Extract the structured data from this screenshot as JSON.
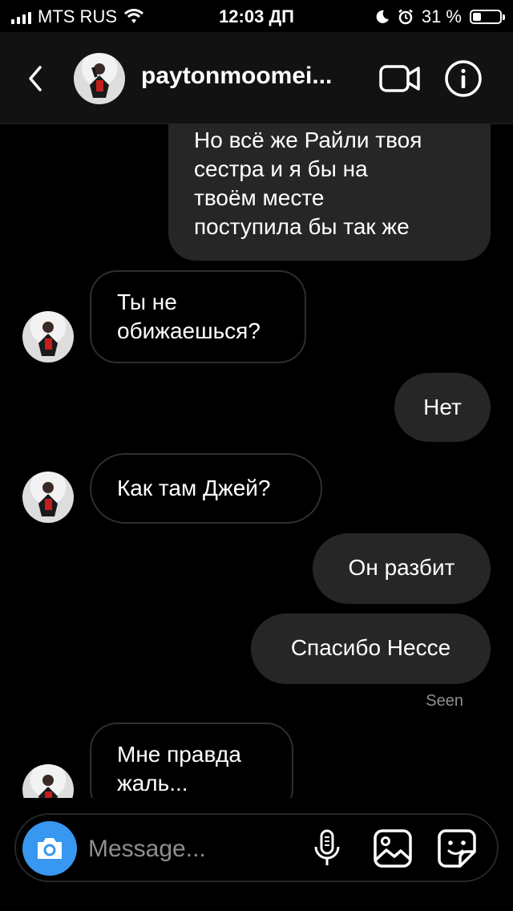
{
  "status_bar": {
    "carrier": "MTS RUS",
    "time": "12:03 ДП",
    "battery_percent": "31 %",
    "battery_level": 0.31
  },
  "header": {
    "username": "paytonmoomei..."
  },
  "messages": [
    {
      "direction": "out",
      "text_lines": [
        "Но всё же Райли твоя",
        "сестра и я бы на",
        "твоём месте",
        "поступила бы так же"
      ]
    },
    {
      "direction": "in",
      "text_lines": [
        "Ты не",
        "обижаешься?"
      ]
    },
    {
      "direction": "out",
      "text_lines": [
        "Нет"
      ]
    },
    {
      "direction": "in",
      "text_lines": [
        "Как там Джей?"
      ]
    },
    {
      "direction": "out",
      "text_lines": [
        "Он разбит"
      ]
    },
    {
      "direction": "out",
      "text_lines": [
        "Спасибо Нессе"
      ]
    },
    {
      "direction": "in",
      "text_lines": [
        "Мне правда",
        "жаль..."
      ]
    }
  ],
  "seen_label": "Seen",
  "composer": {
    "placeholder": "Message..."
  },
  "icons": {
    "back": "chevron-left-icon",
    "video": "video-camera-icon",
    "info": "info-icon",
    "camera": "camera-icon",
    "mic": "microphone-icon",
    "gallery": "gallery-icon",
    "sticker": "sticker-icon"
  },
  "colors": {
    "accent": "#3897f0",
    "background": "#000000",
    "outgoing_bubble": "#262626",
    "header": "#121212"
  }
}
